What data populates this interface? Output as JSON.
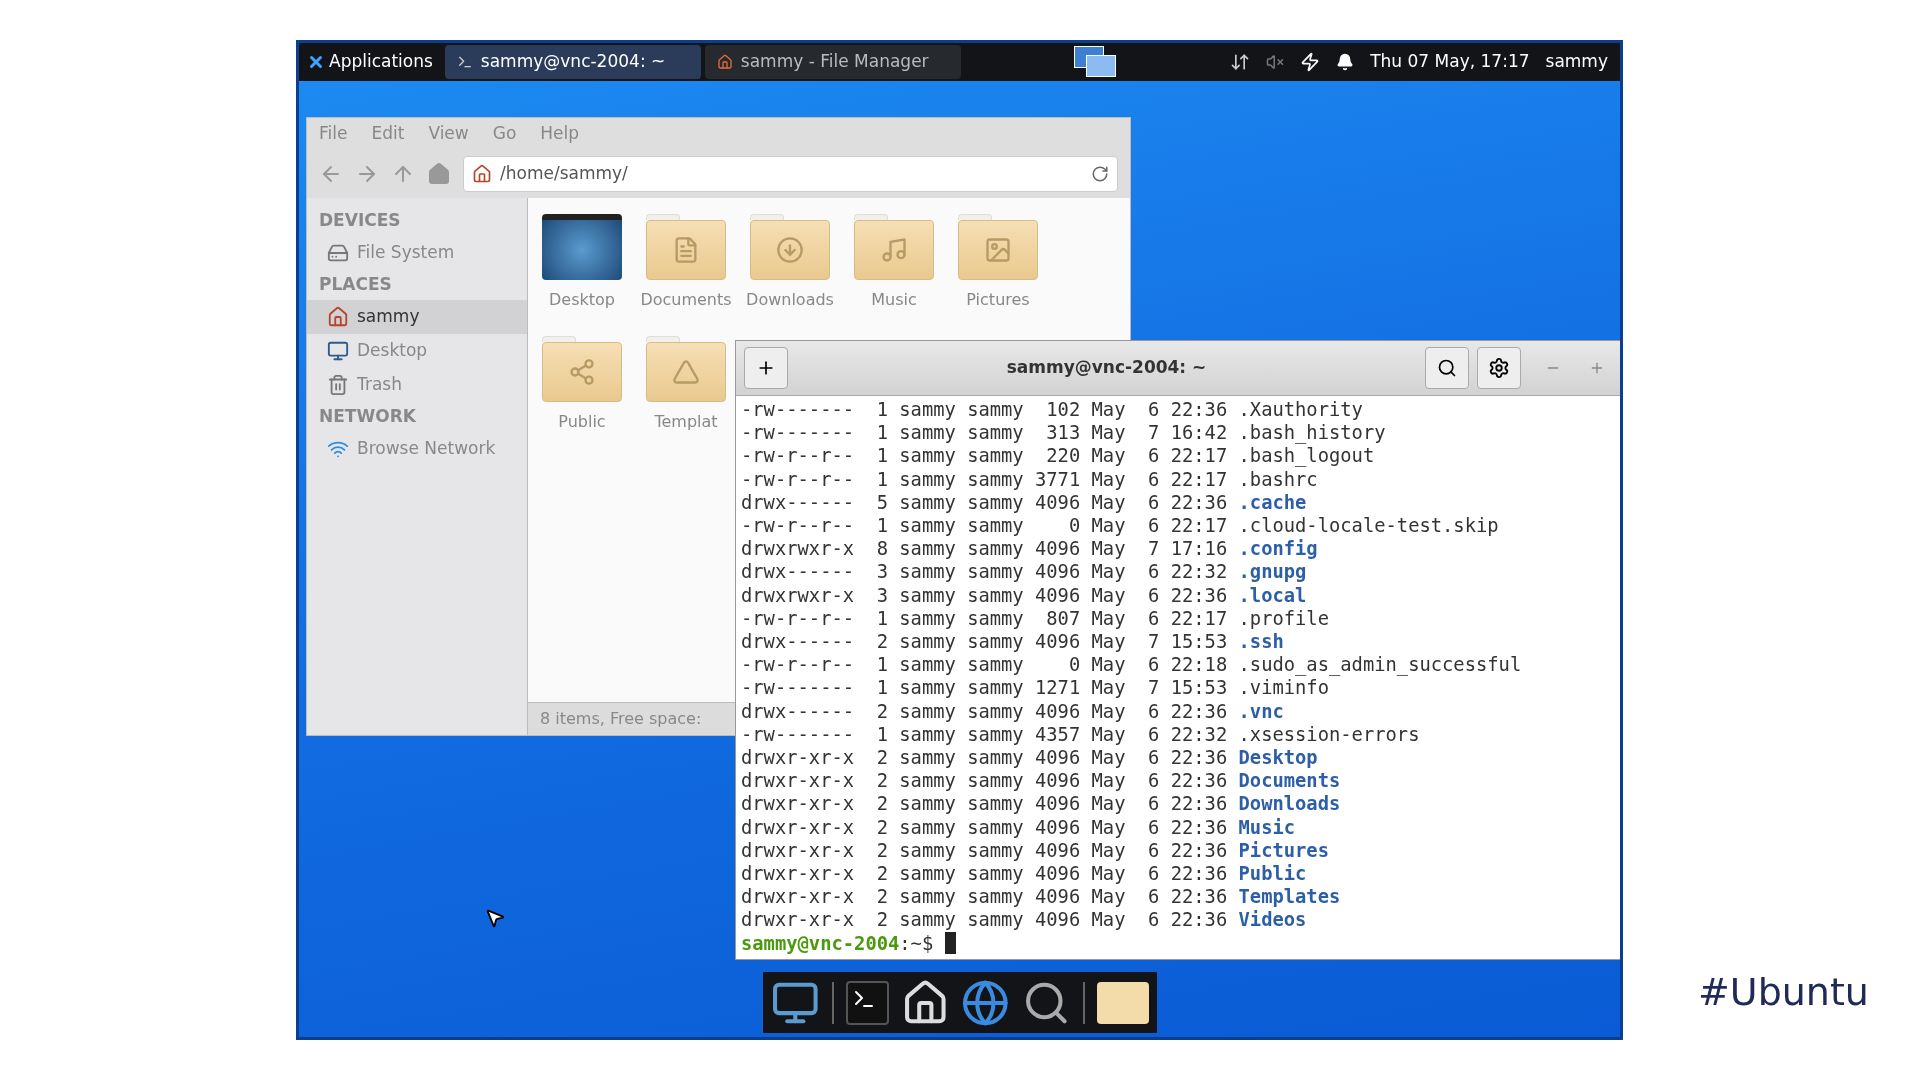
{
  "panel": {
    "app_menu": "Applications",
    "tasks": [
      {
        "title": "sammy@vnc-2004: ~",
        "kind": "terminal",
        "selected": true
      },
      {
        "title": "sammy - File Manager",
        "kind": "home",
        "selected": false
      }
    ],
    "clock": "Thu 07 May, 17:17",
    "user": "sammy"
  },
  "file_manager": {
    "menu": [
      "File",
      "Edit",
      "View",
      "Go",
      "Help"
    ],
    "location": "/home/sammy/",
    "sidebar": [
      {
        "heading": "DEVICES",
        "items": [
          {
            "label": "File System",
            "kind": "drive",
            "selected": false
          }
        ]
      },
      {
        "heading": "PLACES",
        "items": [
          {
            "label": "sammy",
            "kind": "home",
            "selected": true
          },
          {
            "label": "Desktop",
            "kind": "desktop",
            "selected": false
          },
          {
            "label": "Trash",
            "kind": "trash",
            "selected": false
          }
        ]
      },
      {
        "heading": "NETWORK",
        "items": [
          {
            "label": "Browse Network",
            "kind": "network",
            "selected": false
          }
        ]
      }
    ],
    "files": [
      {
        "name": "Desktop",
        "kind": "desktop"
      },
      {
        "name": "Documents",
        "kind": "documents"
      },
      {
        "name": "Downloads",
        "kind": "downloads"
      },
      {
        "name": "Music",
        "kind": "music"
      },
      {
        "name": "Pictures",
        "kind": "pictures"
      },
      {
        "name": "Public",
        "kind": "public"
      },
      {
        "name": "Templat",
        "kind": "templates"
      }
    ],
    "status": "8 items, Free space:"
  },
  "terminal": {
    "title": "sammy@vnc-2004: ~",
    "lines": [
      {
        "text": "-rw-------  1 sammy sammy  102 May  6 22:36",
        "name": ".Xauthority",
        "kind": "file"
      },
      {
        "text": "-rw-------  1 sammy sammy  313 May  7 16:42",
        "name": ".bash_history",
        "kind": "file"
      },
      {
        "text": "-rw-r--r--  1 sammy sammy  220 May  6 22:17",
        "name": ".bash_logout",
        "kind": "file"
      },
      {
        "text": "-rw-r--r--  1 sammy sammy 3771 May  6 22:17",
        "name": ".bashrc",
        "kind": "file"
      },
      {
        "text": "drwx------  5 sammy sammy 4096 May  6 22:36",
        "name": ".cache",
        "kind": "dir"
      },
      {
        "text": "-rw-r--r--  1 sammy sammy    0 May  6 22:17",
        "name": ".cloud-locale-test.skip",
        "kind": "file"
      },
      {
        "text": "drwxrwxr-x  8 sammy sammy 4096 May  7 17:16",
        "name": ".config",
        "kind": "dir"
      },
      {
        "text": "drwx------  3 sammy sammy 4096 May  6 22:32",
        "name": ".gnupg",
        "kind": "dir"
      },
      {
        "text": "drwxrwxr-x  3 sammy sammy 4096 May  6 22:36",
        "name": ".local",
        "kind": "dir"
      },
      {
        "text": "-rw-r--r--  1 sammy sammy  807 May  6 22:17",
        "name": ".profile",
        "kind": "file"
      },
      {
        "text": "drwx------  2 sammy sammy 4096 May  7 15:53",
        "name": ".ssh",
        "kind": "dir"
      },
      {
        "text": "-rw-r--r--  1 sammy sammy    0 May  6 22:18",
        "name": ".sudo_as_admin_successful",
        "kind": "file"
      },
      {
        "text": "-rw-------  1 sammy sammy 1271 May  7 15:53",
        "name": ".viminfo",
        "kind": "file"
      },
      {
        "text": "drwx------  2 sammy sammy 4096 May  6 22:36",
        "name": ".vnc",
        "kind": "dir"
      },
      {
        "text": "-rw-------  1 sammy sammy 4357 May  6 22:32",
        "name": ".xsession-errors",
        "kind": "file"
      },
      {
        "text": "drwxr-xr-x  2 sammy sammy 4096 May  6 22:36",
        "name": "Desktop",
        "kind": "dir"
      },
      {
        "text": "drwxr-xr-x  2 sammy sammy 4096 May  6 22:36",
        "name": "Documents",
        "kind": "dir"
      },
      {
        "text": "drwxr-xr-x  2 sammy sammy 4096 May  6 22:36",
        "name": "Downloads",
        "kind": "dir"
      },
      {
        "text": "drwxr-xr-x  2 sammy sammy 4096 May  6 22:36",
        "name": "Music",
        "kind": "dir"
      },
      {
        "text": "drwxr-xr-x  2 sammy sammy 4096 May  6 22:36",
        "name": "Pictures",
        "kind": "dir"
      },
      {
        "text": "drwxr-xr-x  2 sammy sammy 4096 May  6 22:36",
        "name": "Public",
        "kind": "dir"
      },
      {
        "text": "drwxr-xr-x  2 sammy sammy 4096 May  6 22:36",
        "name": "Templates",
        "kind": "dir"
      },
      {
        "text": "drwxr-xr-x  2 sammy sammy 4096 May  6 22:36",
        "name": "Videos",
        "kind": "dir"
      }
    ],
    "prompt": {
      "user_host": "sammy@vnc-2004",
      "path": ":~$"
    }
  },
  "caption": "#Ubuntu"
}
